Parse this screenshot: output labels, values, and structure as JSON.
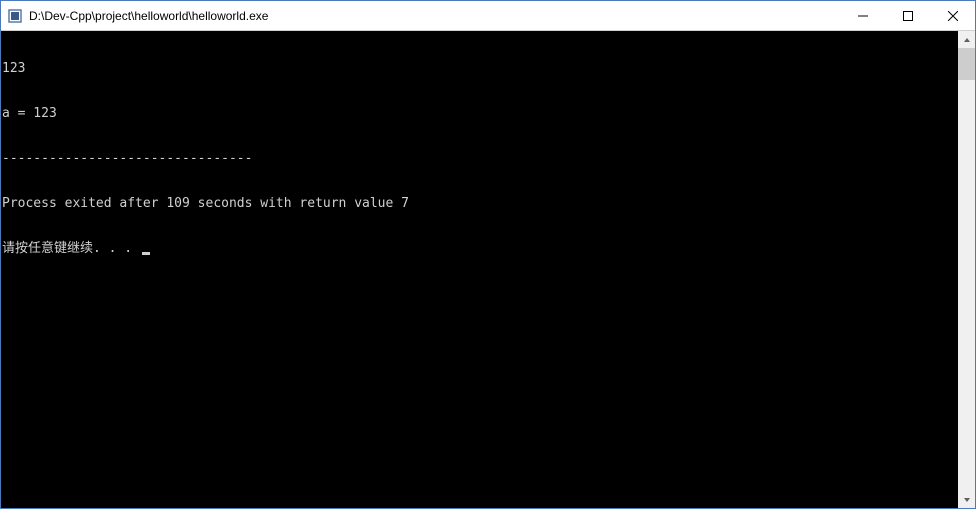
{
  "titlebar": {
    "title": "D:\\Dev-Cpp\\project\\helloworld\\helloworld.exe"
  },
  "console": {
    "line1": "123",
    "line2": "a = 123",
    "divider": "--------------------------------",
    "exit_msg": "Process exited after 109 seconds with return value 7",
    "prompt": "请按任意键继续. . . "
  }
}
